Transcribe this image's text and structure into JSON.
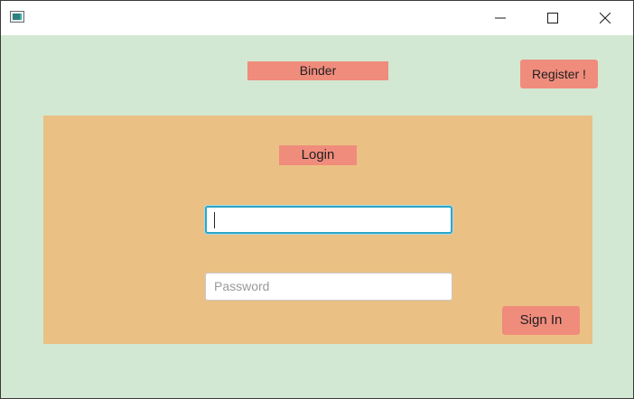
{
  "titlebar": {
    "app_icon": "window-app-icon",
    "minimize_icon": "minimize-icon",
    "maximize_icon": "maximize-icon",
    "close_icon": "close-icon"
  },
  "header": {
    "brand_label": "Binder",
    "register_label": "Register !"
  },
  "login_panel": {
    "title": "Login",
    "username_value": "",
    "password_placeholder": "Password",
    "signin_label": "Sign In"
  },
  "colors": {
    "background": "#d2e8d2",
    "panel": "#ebc084",
    "accent": "#f08c7c",
    "focus_border": "#2ea6c6"
  }
}
